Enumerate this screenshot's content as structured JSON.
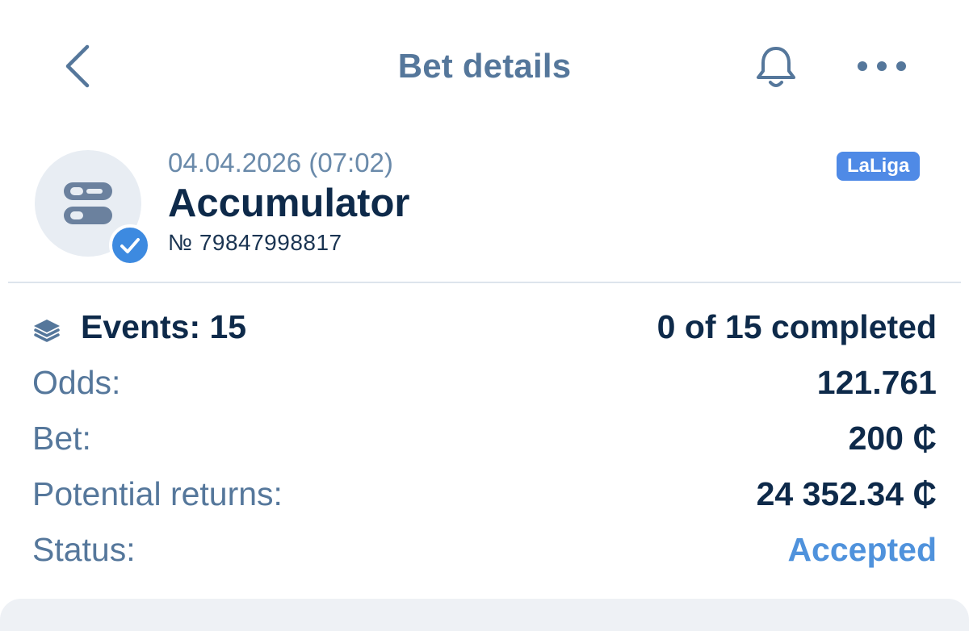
{
  "header": {
    "title": "Bet details",
    "back_icon": "chevron-left-icon",
    "bell_icon": "bell-icon",
    "more_icon": "more-horizontal-icon"
  },
  "bet": {
    "date": "04.04.2026 (07:02)",
    "type": "Accumulator",
    "number": "№ 79847998817",
    "league_badge": "LaLiga",
    "avatar_icon": "accumulator-icon",
    "verified_icon": "checkmark-icon"
  },
  "details": {
    "events_icon": "layers-icon",
    "events_label": "Events: 15",
    "events_progress": "0 of 15 completed",
    "odds_label": "Odds:",
    "odds_value": "121.761",
    "bet_label": "Bet:",
    "bet_value": "200 ₵",
    "returns_label": "Potential returns:",
    "returns_value": "24 352.34 ₵",
    "status_label": "Status:",
    "status_value": "Accepted"
  },
  "colors": {
    "primary_text": "#0e2a4a",
    "muted_text": "#55779b",
    "accent": "#4f8ae6",
    "status_accepted": "#4f92dc"
  }
}
